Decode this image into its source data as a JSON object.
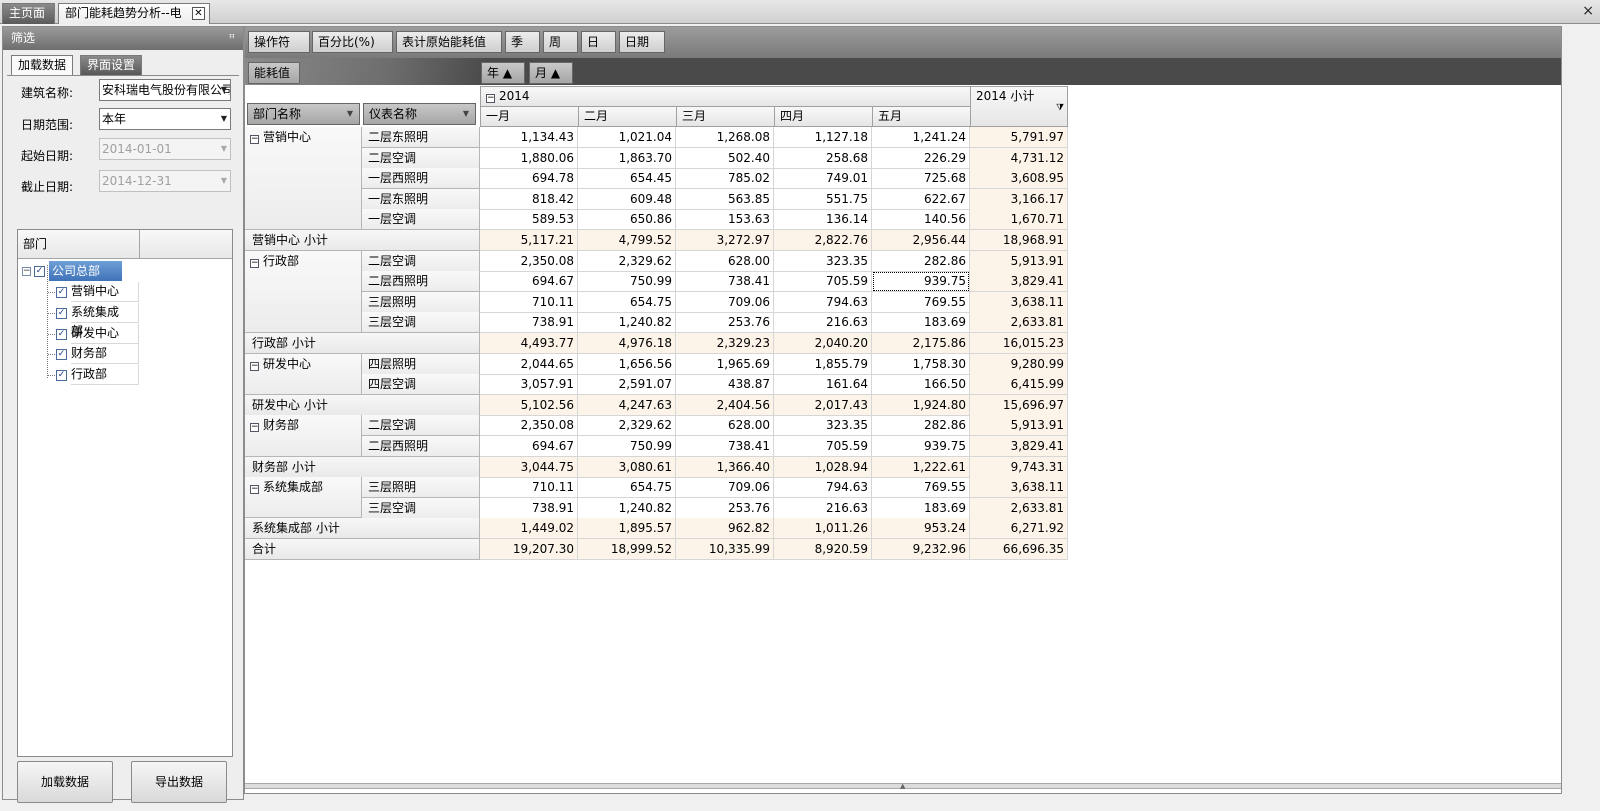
{
  "tabs": {
    "home": "主页面",
    "analysis": "部门能耗趋势分析--电",
    "close_glyph": "✕",
    "window_close_glyph": "×"
  },
  "filter": {
    "title": "筛选",
    "pin_glyph": "ꟸ",
    "subtabs": [
      "加载数据",
      "界面设置"
    ],
    "fields": {
      "building_label": "建筑名称:",
      "building_value": "安科瑞电气股份有限公司",
      "range_label": "日期范围:",
      "range_value": "本年",
      "start_label": "起始日期:",
      "start_value": "2014-01-01",
      "end_label": "截止日期:",
      "end_value": "2014-12-31"
    },
    "tree": {
      "header": "部门",
      "root": "公司总部",
      "children": [
        "营销中心",
        "系统集成部",
        "研发中心",
        "财务部",
        "行政部"
      ]
    },
    "buttons": {
      "load": "加载数据",
      "export": "导出数据"
    }
  },
  "pivot": {
    "filter_fields": [
      "操作符",
      "百分比(%)",
      "表计原始能耗值",
      "季",
      "周",
      "日",
      "日期"
    ],
    "data_field": "能耗值",
    "column_fields": [
      "年 ▲",
      "月 ▲"
    ],
    "row_fields": [
      "部门名称",
      "仪表名称"
    ],
    "year_header": "2014",
    "year_subtotal_header": "2014 小计",
    "months": [
      "一月",
      "二月",
      "三月",
      "四月",
      "五月"
    ],
    "rows": [
      {
        "type": "group",
        "dept": "营销中心",
        "meters": [
          {
            "meter": "二层东照明",
            "values": [
              "1,134.43",
              "1,021.04",
              "1,268.08",
              "1,127.18",
              "1,241.24"
            ],
            "total": "5,791.97"
          },
          {
            "meter": "二层空调",
            "values": [
              "1,880.06",
              "1,863.70",
              "502.40",
              "258.68",
              "226.29"
            ],
            "total": "4,731.12"
          },
          {
            "meter": "一层西照明",
            "values": [
              "694.78",
              "654.45",
              "785.02",
              "749.01",
              "725.68"
            ],
            "total": "3,608.95"
          },
          {
            "meter": "一层东照明",
            "values": [
              "818.42",
              "609.48",
              "563.85",
              "551.75",
              "622.67"
            ],
            "total": "3,166.17"
          },
          {
            "meter": "一层空调",
            "values": [
              "589.53",
              "650.86",
              "153.63",
              "136.14",
              "140.56"
            ],
            "total": "1,670.71"
          }
        ]
      },
      {
        "type": "subtotal",
        "label": "营销中心 小计",
        "values": [
          "5,117.21",
          "4,799.52",
          "3,272.97",
          "2,822.76",
          "2,956.44"
        ],
        "total": "18,968.91"
      },
      {
        "type": "group",
        "dept": "行政部",
        "meters": [
          {
            "meter": "二层空调",
            "values": [
              "2,350.08",
              "2,329.62",
              "628.00",
              "323.35",
              "282.86"
            ],
            "total": "5,913.91"
          },
          {
            "meter": "二层西照明",
            "values": [
              "694.67",
              "750.99",
              "738.41",
              "705.59",
              "939.75"
            ],
            "total": "3,829.41"
          },
          {
            "meter": "三层照明",
            "values": [
              "710.11",
              "654.75",
              "709.06",
              "794.63",
              "769.55"
            ],
            "total": "3,638.11"
          },
          {
            "meter": "三层空调",
            "values": [
              "738.91",
              "1,240.82",
              "253.76",
              "216.63",
              "183.69"
            ],
            "total": "2,633.81"
          }
        ]
      },
      {
        "type": "subtotal",
        "label": "行政部 小计",
        "values": [
          "4,493.77",
          "4,976.18",
          "2,329.23",
          "2,040.20",
          "2,175.86"
        ],
        "total": "16,015.23"
      },
      {
        "type": "group",
        "dept": "研发中心",
        "meters": [
          {
            "meter": "四层照明",
            "values": [
              "2,044.65",
              "1,656.56",
              "1,965.69",
              "1,855.79",
              "1,758.30"
            ],
            "total": "9,280.99"
          },
          {
            "meter": "四层空调",
            "values": [
              "3,057.91",
              "2,591.07",
              "438.87",
              "161.64",
              "166.50"
            ],
            "total": "6,415.99"
          }
        ]
      },
      {
        "type": "subtotal",
        "label": "研发中心 小计",
        "values": [
          "5,102.56",
          "4,247.63",
          "2,404.56",
          "2,017.43",
          "1,924.80"
        ],
        "total": "15,696.97"
      },
      {
        "type": "group",
        "dept": "财务部",
        "meters": [
          {
            "meter": "二层空调",
            "values": [
              "2,350.08",
              "2,329.62",
              "628.00",
              "323.35",
              "282.86"
            ],
            "total": "5,913.91"
          },
          {
            "meter": "二层西照明",
            "values": [
              "694.67",
              "750.99",
              "738.41",
              "705.59",
              "939.75"
            ],
            "total": "3,829.41"
          }
        ]
      },
      {
        "type": "subtotal",
        "label": "财务部 小计",
        "values": [
          "3,044.75",
          "3,080.61",
          "1,366.40",
          "1,028.94",
          "1,222.61"
        ],
        "total": "9,743.31"
      },
      {
        "type": "group",
        "dept": "系统集成部",
        "meters": [
          {
            "meter": "三层照明",
            "values": [
              "710.11",
              "654.75",
              "709.06",
              "794.63",
              "769.55"
            ],
            "total": "3,638.11"
          },
          {
            "meter": "三层空调",
            "values": [
              "738.91",
              "1,240.82",
              "253.76",
              "216.63",
              "183.69"
            ],
            "total": "2,633.81"
          }
        ]
      },
      {
        "type": "subtotal",
        "label": "系统集成部 小计",
        "values": [
          "1,449.02",
          "1,895.57",
          "962.82",
          "1,011.26",
          "953.24"
        ],
        "total": "6,271.92"
      },
      {
        "type": "total",
        "label": "合计",
        "values": [
          "19,207.30",
          "18,999.52",
          "10,335.99",
          "8,920.59",
          "9,232.96"
        ],
        "total": "66,696.35"
      }
    ]
  }
}
